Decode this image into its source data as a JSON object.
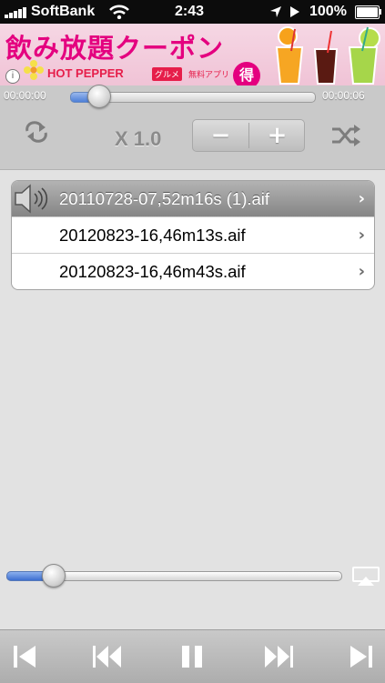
{
  "status_bar": {
    "carrier": "SoftBank",
    "time": "2:43",
    "battery": "100%"
  },
  "ad": {
    "headline": "飲み放題クーポン",
    "brand": "HOT PEPPER",
    "category": "グルメ",
    "free_app": "無料アプリ",
    "badge": "得",
    "brand_color": "#e4007f"
  },
  "player": {
    "elapsed": "00:00:00",
    "total": "00:00:06",
    "seek_progress": 0.12,
    "speed": "X 1.0",
    "minus_label": "−",
    "plus_label": "+",
    "repeat_icon": "repeat-icon",
    "shuffle_icon": "shuffle-icon"
  },
  "playlist": {
    "items": [
      {
        "title": "20110728-07,52m16s (1).aif",
        "playing": true
      },
      {
        "title": "20120823-16,46m13s.aif",
        "playing": false
      },
      {
        "title": "20120823-16,46m43s.aif",
        "playing": false
      }
    ],
    "chevron": "›"
  },
  "volume": {
    "level": 0.14,
    "airplay_icon": "airplay-icon"
  },
  "toolbar": {
    "buttons": [
      "skip-to-start-icon",
      "rewind-icon",
      "pause-icon",
      "fast-forward-icon",
      "skip-to-end-icon"
    ]
  },
  "colors": {
    "accent_blue": "#4d7fd8",
    "toolbar_gray": "#adadad"
  }
}
